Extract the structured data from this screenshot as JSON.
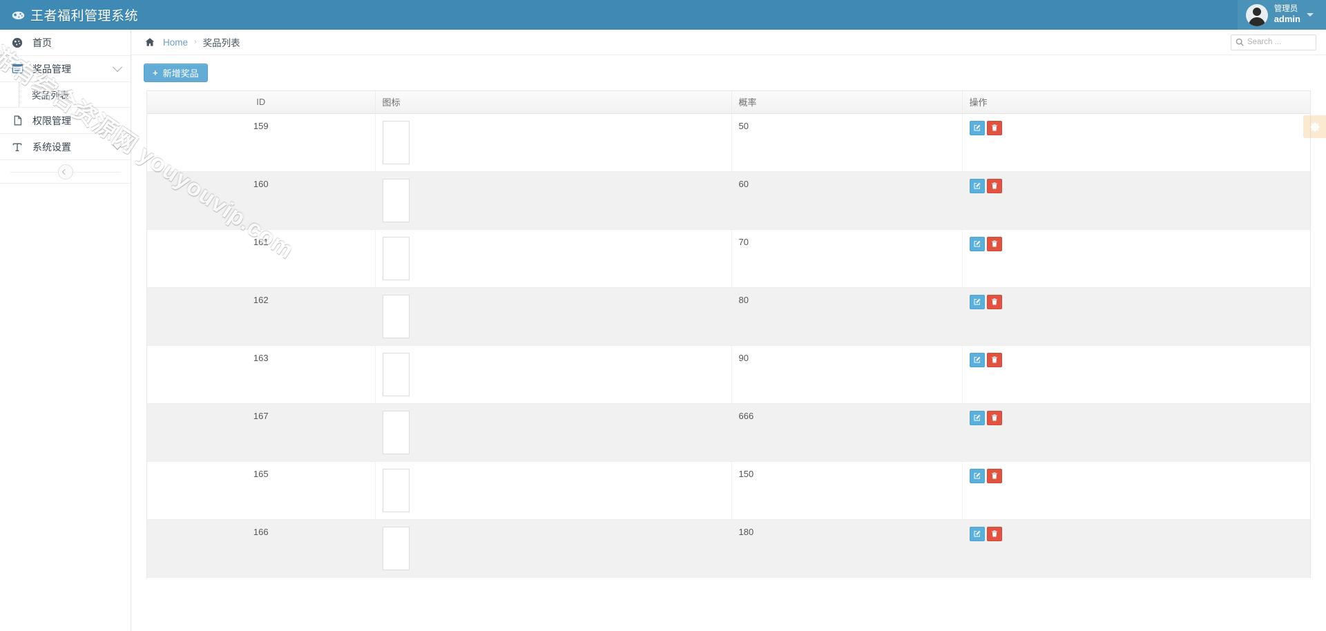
{
  "header": {
    "title": "王者福利管理系统",
    "logo_icon": "gamepad-icon",
    "user": {
      "role": "管理员",
      "login": "admin",
      "avatar_icon": "user-avatar-icon",
      "caret_icon": "caret-down-icon"
    }
  },
  "sidebar": {
    "items": [
      {
        "label": "首页",
        "icon": "dashboard-icon",
        "has_children": false,
        "active": false
      },
      {
        "label": "奖品管理",
        "icon": "list-box-icon",
        "has_children": true,
        "active": true
      },
      {
        "label": "权限管理",
        "icon": "file-icon",
        "has_children": false,
        "active": false
      },
      {
        "label": "系统设置",
        "icon": "text-t-icon",
        "has_children": true,
        "active": false
      }
    ],
    "submenu": {
      "parent": "奖品管理",
      "items": [
        {
          "label": "奖品列表",
          "active": true
        }
      ]
    },
    "collapse_icon": "chevron-left-circle-icon"
  },
  "breadcrumb": {
    "home_icon": "home-icon",
    "home_label": "Home",
    "separator": "›",
    "current": "奖品列表"
  },
  "search": {
    "icon": "search-icon",
    "placeholder": "Search ...",
    "value": ""
  },
  "toolbar": {
    "add_label": "新增奖品",
    "add_icon": "plus-icon"
  },
  "settings_tab": {
    "icon": "gear-icon",
    "color": "#f8b86a"
  },
  "table": {
    "columns": [
      {
        "key": "id",
        "label": "ID"
      },
      {
        "key": "icon",
        "label": "图标"
      },
      {
        "key": "prob",
        "label": "概率"
      },
      {
        "key": "act",
        "label": "操作"
      }
    ],
    "actions": {
      "edit_icon": "pencil-square-icon",
      "edit_color": "#5ab0dd",
      "delete_icon": "trash-icon",
      "delete_color": "#e15241"
    },
    "rows": [
      {
        "id": "159",
        "prob": "50",
        "thumb_top": "#8a9c86",
        "thumb_mid": "#c9bfa8",
        "thumb_bot": "#3d4a46"
      },
      {
        "id": "160",
        "prob": "60",
        "thumb_top": "#3b4f66",
        "thumb_mid": "#7d8fa8",
        "thumb_bot": "#1d2b3c"
      },
      {
        "id": "161",
        "prob": "70",
        "thumb_top": "#6b5a3a",
        "thumb_mid": "#b79a63",
        "thumb_bot": "#3a3224"
      },
      {
        "id": "162",
        "prob": "80",
        "thumb_top": "#4a3a5e",
        "thumb_mid": "#8f7a93",
        "thumb_bot": "#241c30"
      },
      {
        "id": "163",
        "prob": "90",
        "thumb_top": "#5a4a78",
        "thumb_mid": "#a295c2",
        "thumb_bot": "#2b2240"
      },
      {
        "id": "167",
        "prob": "666",
        "thumb_top": "#1f2a66",
        "thumb_mid": "#b8413a",
        "thumb_bot": "#141c44"
      },
      {
        "id": "165",
        "prob": "150",
        "thumb_top": "#6d4030",
        "thumb_mid": "#c08a5e",
        "thumb_bot": "#35201a"
      },
      {
        "id": "166",
        "prob": "180",
        "thumb_top": "#4a2d6e",
        "thumb_mid": "#7a5fae",
        "thumb_bot": "#231539"
      }
    ]
  },
  "watermark": {
    "text": "游有综合资源网 youyouvip.com"
  },
  "colors": {
    "header_bg": "#3e8ab4",
    "link": "#6b9fc4",
    "add_button": "#62acd6",
    "stripe": "#f1f1f1"
  }
}
